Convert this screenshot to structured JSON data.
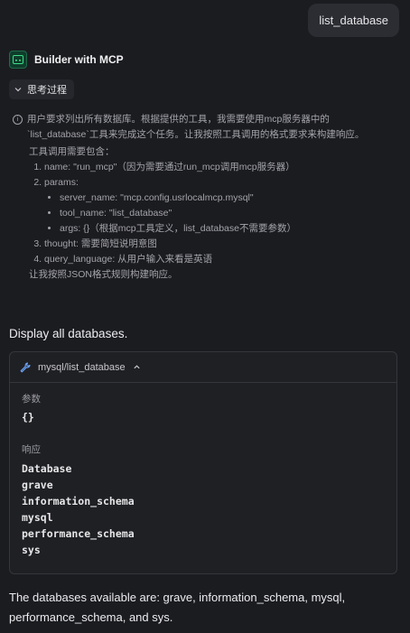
{
  "user_message": "list_database",
  "assistant": {
    "name": "Builder with MCP"
  },
  "thinking": {
    "toggle_label": "思考过程",
    "intro_line1": "用户要求列出所有数据库。根据提供的工具，我需要使用mcp服务器中的",
    "intro_line2": "`list_database`工具来完成这个任务。让我按照工具调用的格式要求来构建响应。",
    "requirements_title": "工具调用需要包含：",
    "items": [
      {
        "text": "name: \"run_mcp\"（因为需要通过run_mcp调用mcp服务器）"
      },
      {
        "text": "params:"
      },
      {
        "text": "thought: 需要简短说明意图"
      },
      {
        "text": "query_language: 从用户输入来看是英语"
      }
    ],
    "params": [
      "server_name: \"mcp.config.usrlocalmcp.mysql\"",
      "tool_name: \"list_database\"",
      "args: {}（根据mcp工具定义，list_database不需要参数）"
    ],
    "closing": "让我按照JSON格式规则构建响应。"
  },
  "display_text": "Display all databases.",
  "tool_call": {
    "label": "mysql/list_database",
    "params_label": "参数",
    "params_value": "{}",
    "response_label": "响应",
    "response_rows": [
      "Database",
      "grave",
      "information_schema",
      "mysql",
      "performance_schema",
      "sys"
    ]
  },
  "final_answer": "The databases available are: grave, information_schema, mysql, performance_schema, and sys."
}
